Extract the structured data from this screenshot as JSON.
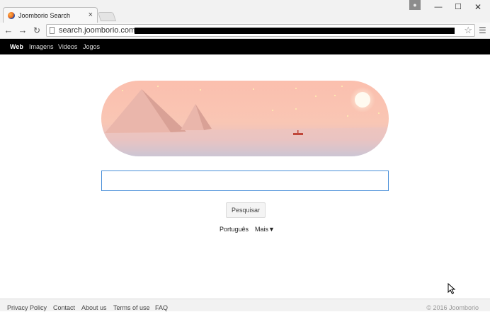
{
  "browser": {
    "tab_title": "Joomborio Search",
    "tab_close": "×",
    "url": "search.joomborio.com",
    "window_controls": {
      "minimize": "—",
      "maximize": "☐",
      "close": "✕"
    },
    "nav_icons": {
      "back": "back-arrow-icon",
      "forward": "forward-arrow-icon",
      "reload": "reload-icon",
      "star": "star-icon",
      "menu": "hamburger-menu-icon"
    }
  },
  "page_nav": {
    "items": [
      {
        "label": "Web",
        "active": true
      },
      {
        "label": "Imagens",
        "active": false
      },
      {
        "label": "Videos",
        "active": false
      },
      {
        "label": "Jogos",
        "active": false
      }
    ]
  },
  "search": {
    "value": "",
    "button_label": "Pesquisar"
  },
  "language": {
    "current": "Português",
    "more": "Mais▼"
  },
  "footer": {
    "links": [
      "Privacy Policy",
      "Contact",
      "About us",
      "Terms of use",
      "FAQ"
    ],
    "copyright": "© 2016 Joomborio"
  },
  "colors": {
    "nav_bar": "#000000",
    "search_border": "#4a90d9",
    "hero_sky_top": "#f8c0ae",
    "hero_sky_bottom": "#a8c6e6"
  }
}
